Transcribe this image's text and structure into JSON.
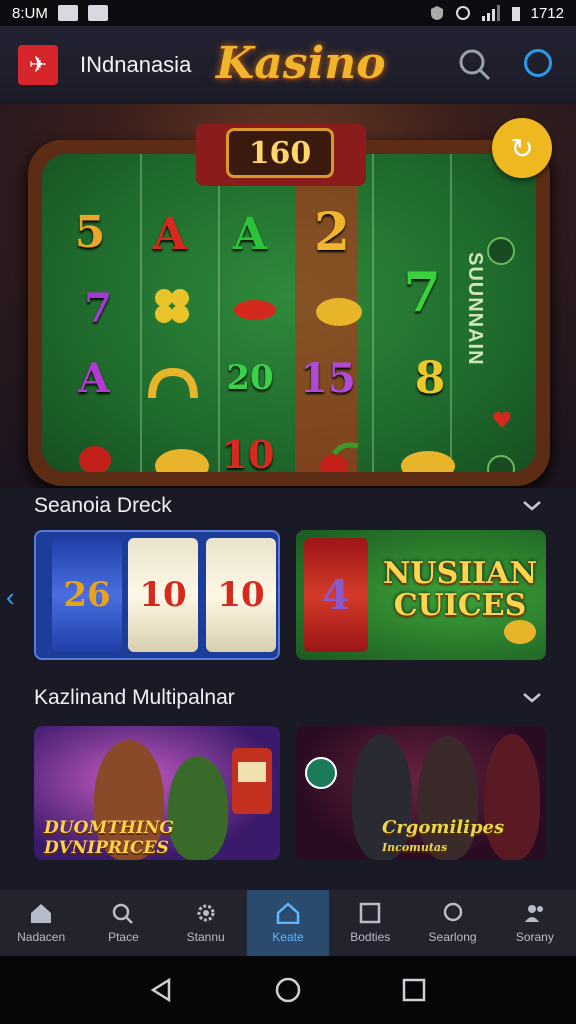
{
  "status_bar": {
    "time": "8:UM",
    "clock": "1712"
  },
  "app_bar": {
    "app_name": "INdnanasia",
    "brand": "Kasino"
  },
  "hero": {
    "jackpot": "160",
    "side_text": "SUUNNAIN",
    "symbols": [
      "5",
      "A",
      "A",
      "2",
      "7",
      "7",
      "A",
      "20",
      "15",
      "8",
      "10"
    ]
  },
  "sections": [
    {
      "title": "Seanoia Dreck"
    },
    {
      "title": "Kazlinand Multipalnar"
    }
  ],
  "games": {
    "reel_card": {
      "reels": [
        "26",
        "10",
        "10"
      ]
    },
    "green_card": {
      "reel_value": "4",
      "title_line1": "NUSIIAN",
      "title_line2": "CUICES"
    }
  },
  "promos": [
    {
      "title_line1": "DUOMTHING",
      "title_line2": "DVNIPRICES"
    },
    {
      "title_line1": "Crgomilipes",
      "title_line2": "Incomutas"
    }
  ],
  "bottom_nav": [
    {
      "label": "Nadacen",
      "icon": "home-icon"
    },
    {
      "label": "Ptace",
      "icon": "search-icon"
    },
    {
      "label": "Stannu",
      "icon": "gear-icon"
    },
    {
      "label": "Keate",
      "icon": "home-icon",
      "active": true
    },
    {
      "label": "Bodties",
      "icon": "square-icon"
    },
    {
      "label": "Searlong",
      "icon": "search-icon"
    },
    {
      "label": "Sorany",
      "icon": "people-icon"
    }
  ],
  "colors": {
    "accent": "#2aa5e6",
    "gold": "#f0b52a",
    "felt": "#1f6b2c"
  }
}
